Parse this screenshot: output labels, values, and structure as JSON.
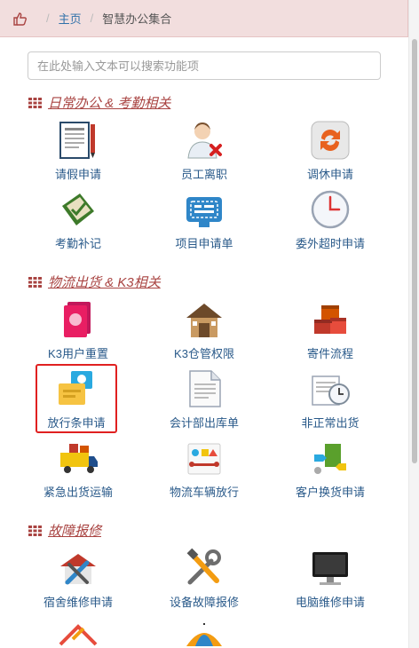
{
  "breadcrumb": {
    "home": "主页",
    "current": "智慧办公集合"
  },
  "search": {
    "placeholder": "在此处输入文本可以搜索功能项"
  },
  "sections": [
    {
      "title": "日常办公 & 考勤相关"
    },
    {
      "title": "物流出货 & K3相关"
    },
    {
      "title": "故障报修"
    }
  ],
  "tiles": [
    {
      "label": "请假申请",
      "icon": "leave-form-icon"
    },
    {
      "label": "员工离职",
      "icon": "resign-icon"
    },
    {
      "label": "调休申请",
      "icon": "shift-swap-icon"
    },
    {
      "label": "考勤补记",
      "icon": "attendance-icon"
    },
    {
      "label": "项目申请单",
      "icon": "project-icon"
    },
    {
      "label": "委外超时申请",
      "icon": "clock-icon"
    },
    {
      "label": "K3用户重置",
      "icon": "k3-user-icon"
    },
    {
      "label": "K3仓管权限",
      "icon": "warehouse-icon"
    },
    {
      "label": "寄件流程",
      "icon": "parcel-icon"
    },
    {
      "label": "放行条申请",
      "icon": "pass-slip-icon"
    },
    {
      "label": "会计部出库单",
      "icon": "document-icon"
    },
    {
      "label": "非正常出货",
      "icon": "abnormal-shipment-icon"
    },
    {
      "label": "紧急出货运输",
      "icon": "truck-icon"
    },
    {
      "label": "物流车辆放行",
      "icon": "vehicle-release-icon"
    },
    {
      "label": "客户换货申请",
      "icon": "exchange-icon"
    },
    {
      "label": "宿舍维修申请",
      "icon": "dorm-repair-icon"
    },
    {
      "label": "设备故障报修",
      "icon": "tools-icon"
    },
    {
      "label": "电脑维修申请",
      "icon": "monitor-icon"
    }
  ],
  "colors": {
    "accent": "#a94442",
    "link": "#3071a9",
    "selected_border": "#e02020",
    "breadcrumb_bg": "#f2dede"
  }
}
